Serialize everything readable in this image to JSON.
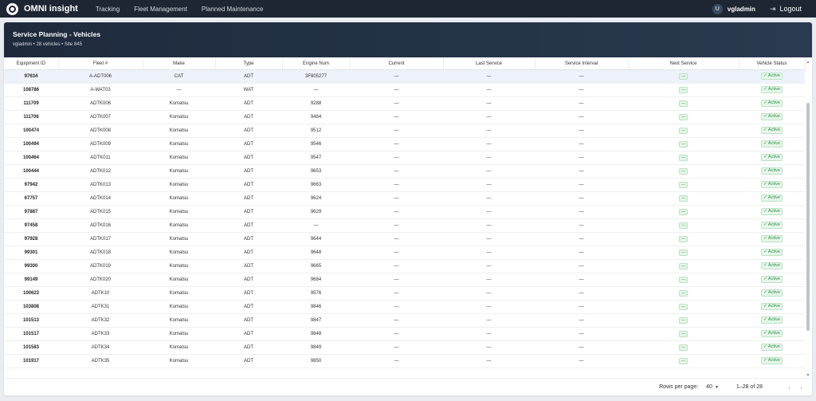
{
  "app": {
    "brand": "OMNI insight",
    "nav": [
      "Tracking",
      "Fleet Management",
      "Planned Maintenance"
    ],
    "user_initial": "U",
    "user": "vgladmin",
    "logout": "Logout"
  },
  "header": {
    "title": "Service Planning - Vehicles",
    "subtitle": "vgladmin • 28 vehicles • Site 845"
  },
  "table": {
    "columns": [
      "Equipment ID",
      "Fleet #",
      "Make",
      "Type",
      "Engine Num",
      "Current",
      "Last Service",
      "Service Interval",
      "Next Service",
      "Vehicle Status"
    ],
    "rows": [
      [
        "97634",
        "A-ADT006",
        "CAT",
        "ADT",
        "3F805277",
        "—",
        "—",
        "—",
        "—",
        "✓ Active"
      ],
      [
        "108786",
        "A-WAT03",
        "—",
        "WAT",
        "—",
        "—",
        "—",
        "—",
        "—",
        "✓ Active"
      ],
      [
        "111709",
        "ADTK006",
        "Komatsu",
        "ADT",
        "9288",
        "—",
        "—",
        "—",
        "—",
        "✓ Active"
      ],
      [
        "111706",
        "ADTK007",
        "Komatsu",
        "ADT",
        "9484",
        "—",
        "—",
        "—",
        "—",
        "✓ Active"
      ],
      [
        "100474",
        "ADTK008",
        "Komatsu",
        "ADT",
        "9512",
        "—",
        "—",
        "—",
        "—",
        "✓ Active"
      ],
      [
        "100494",
        "ADTK009",
        "Komatsu",
        "ADT",
        "9546",
        "—",
        "—",
        "—",
        "—",
        "✓ Active"
      ],
      [
        "100464",
        "ADTK011",
        "Komatsu",
        "ADT",
        "9547",
        "—",
        "—",
        "—",
        "—",
        "✓ Active"
      ],
      [
        "100444",
        "ADTK012",
        "Komatsu",
        "ADT",
        "9653",
        "—",
        "—",
        "—",
        "—",
        "✓ Active"
      ],
      [
        "97942",
        "ADTK013",
        "Komatsu",
        "ADT",
        "9663",
        "—",
        "—",
        "—",
        "—",
        "✓ Active"
      ],
      [
        "67757",
        "ADTK014",
        "Komatsu",
        "ADT",
        "9624",
        "—",
        "—",
        "—",
        "—",
        "✓ Active"
      ],
      [
        "97887",
        "ADTK015",
        "Komatsu",
        "ADT",
        "9629",
        "—",
        "—",
        "—",
        "—",
        "✓ Active"
      ],
      [
        "97458",
        "ADTK016",
        "Komatsu",
        "ADT",
        "—",
        "—",
        "—",
        "—",
        "—",
        "✓ Active"
      ],
      [
        "97928",
        "ADTK017",
        "Komatsu",
        "ADT",
        "9644",
        "—",
        "—",
        "—",
        "—",
        "✓ Active"
      ],
      [
        "99301",
        "ADTK018",
        "Komatsu",
        "ADT",
        "9648",
        "—",
        "—",
        "—",
        "—",
        "✓ Active"
      ],
      [
        "99300",
        "ADTK019",
        "Komatsu",
        "ADT",
        "9665",
        "—",
        "—",
        "—",
        "—",
        "✓ Active"
      ],
      [
        "99149",
        "ADTK020",
        "Komatsu",
        "ADT",
        "9684",
        "—",
        "—",
        "—",
        "—",
        "✓ Active"
      ],
      [
        "100623",
        "ADTK10",
        "Komatsu",
        "ADT",
        "9576",
        "—",
        "—",
        "—",
        "—",
        "✓ Active"
      ],
      [
        "103808",
        "ADTK31",
        "Komatsu",
        "ADT",
        "9846",
        "—",
        "—",
        "—",
        "—",
        "✓ Active"
      ],
      [
        "101513",
        "ADTK32",
        "Komatsu",
        "ADT",
        "9847",
        "—",
        "—",
        "—",
        "—",
        "✓ Active"
      ],
      [
        "101517",
        "ADTK33",
        "Komatsu",
        "ADT",
        "9848",
        "—",
        "—",
        "—",
        "—",
        "✓ Active"
      ],
      [
        "101583",
        "ADTK34",
        "Komatsu",
        "ADT",
        "9849",
        "—",
        "—",
        "—",
        "—",
        "✓ Active"
      ],
      [
        "101917",
        "ADTK35",
        "Komatsu",
        "ADT",
        "9850",
        "—",
        "—",
        "—",
        "—",
        "✓ Active"
      ]
    ]
  },
  "footer": {
    "rows_per_page_label": "Rows per page:",
    "rows_per_page": "40",
    "range": "1–28 of 28",
    "prev": "‹",
    "next": "›"
  },
  "colors": {
    "topbar": "#1e2633",
    "header": "#1e2a3c",
    "active_green": "#2b8f45"
  },
  "icons": {
    "logo": "omni-logo-icon",
    "logout": "logout-icon",
    "dropdown": "chevron-down-icon",
    "check": "check-icon"
  }
}
